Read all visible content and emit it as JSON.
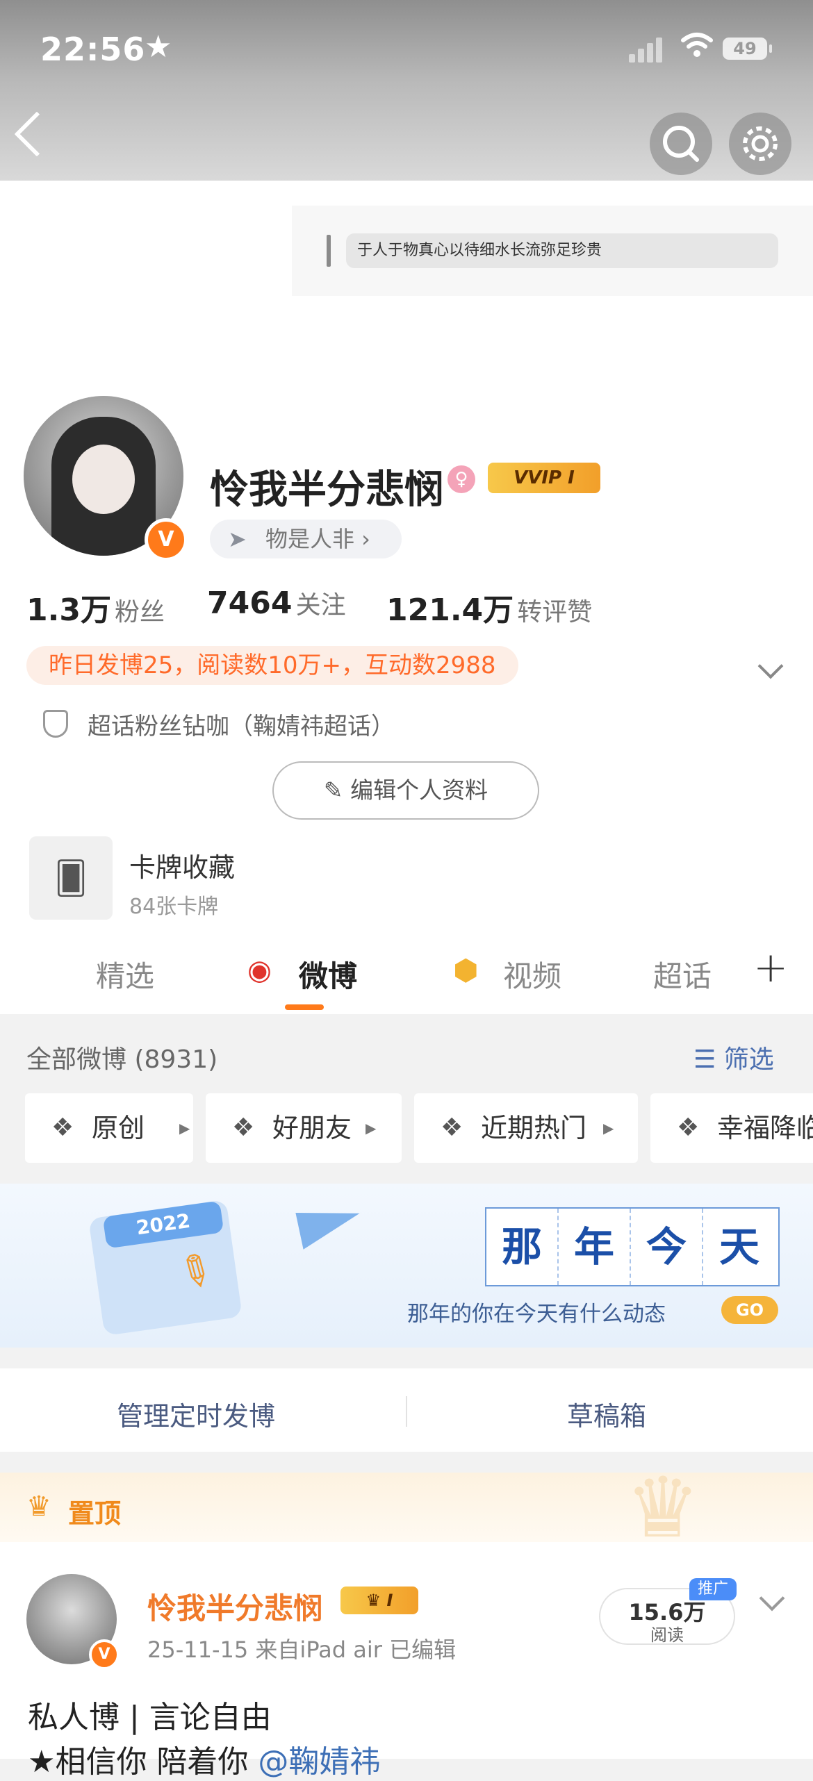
{
  "status_bar": {
    "time": "22:56",
    "battery": "49"
  },
  "cover": {
    "quote": "于人于物真心以待细水长流弥足珍贵"
  },
  "profile": {
    "username": "怜我半分悲悯",
    "vip_badge": "VVIP I",
    "verified_mark": "V",
    "gender_icon": "female-icon",
    "mood_tag": "物是人非 ›",
    "stats": [
      {
        "value": "1.3万",
        "label": "粉丝"
      },
      {
        "value": "7464",
        "label": "关注"
      },
      {
        "value": "121.4万",
        "label": "转评赞"
      }
    ],
    "yesterday_summary": "昨日发博25，阅读数10万+，互动数2988",
    "super_topic": "超话粉丝钻咖（鞠婧祎超话）",
    "edit_button": "编辑个人资料"
  },
  "cards": {
    "title": "卡牌收藏",
    "subtitle": "84张卡牌"
  },
  "tabs": [
    {
      "label": "精选",
      "active": false
    },
    {
      "label": "微博",
      "active": true
    },
    {
      "label": "视频",
      "active": false
    },
    {
      "label": "超话",
      "active": false
    }
  ],
  "feed": {
    "all_label": "全部微博 (8931)",
    "filter_label": "筛选",
    "chips": [
      "原创",
      "好朋友",
      "近期热门",
      "幸福降临"
    ]
  },
  "banner": {
    "calendar_year": "2022",
    "title_chars": [
      "那",
      "年",
      "今",
      "天"
    ],
    "subtitle": "那年的你在今天有什么动态",
    "go": "GO"
  },
  "manage": {
    "schedule": "管理定时发博",
    "drafts": "草稿箱"
  },
  "pinned": {
    "label": "置顶"
  },
  "post": {
    "author": "怜我半分悲悯",
    "vip_badge": "I",
    "meta": "25-11-15  来自iPad air  已编辑",
    "reads_value": "15.6万",
    "reads_label": "阅读",
    "promo": "推广",
    "line1": "私人博 | 言论自由",
    "line2_prefix": "★相信你 陪着你 ",
    "line2_mention": "@鞠婧祎"
  },
  "colors": {
    "accent": "#ff7a1a",
    "link": "#3d6fb6",
    "filter_blue": "#4b6fb0"
  }
}
